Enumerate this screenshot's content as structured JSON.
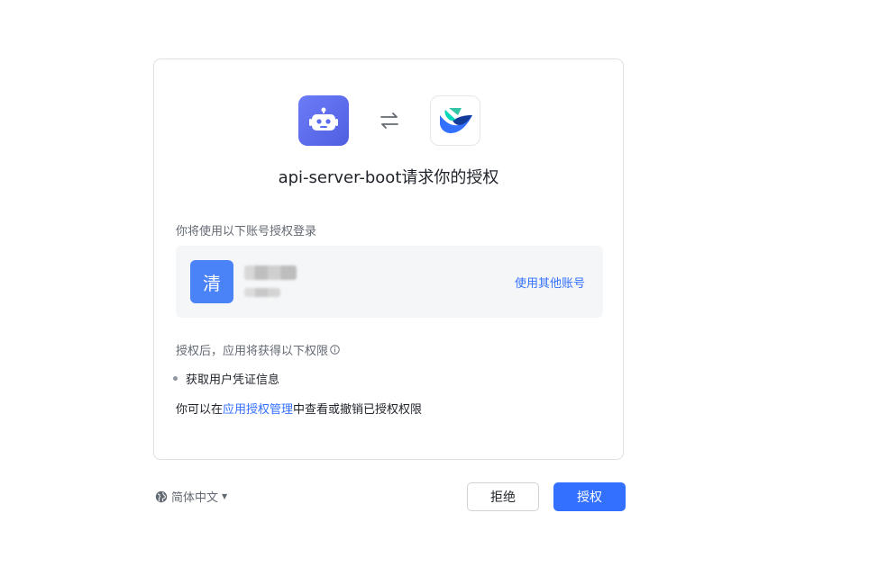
{
  "header": {
    "title": "api-server-boot请求你的授权"
  },
  "icons": {
    "app": "robot-icon",
    "swap": "swap-arrows-icon",
    "platform": "feishu-icon"
  },
  "account": {
    "hint": "你将使用以下账号授权登录",
    "avatar_text": "清",
    "switch_label": "使用其他账号"
  },
  "permissions": {
    "hint": "授权后，应用将获得以下权限",
    "items": [
      "获取用户凭证信息"
    ]
  },
  "manage": {
    "prefix": "你可以在",
    "link": "应用授权管理",
    "suffix": "中查看或撤销已授权权限"
  },
  "footer": {
    "language": "简体中文",
    "reject_label": "拒绝",
    "accept_label": "授权"
  },
  "colors": {
    "primary": "#3370ff",
    "avatar": "#4a82f7",
    "app_icon": "#5b6cf0"
  }
}
